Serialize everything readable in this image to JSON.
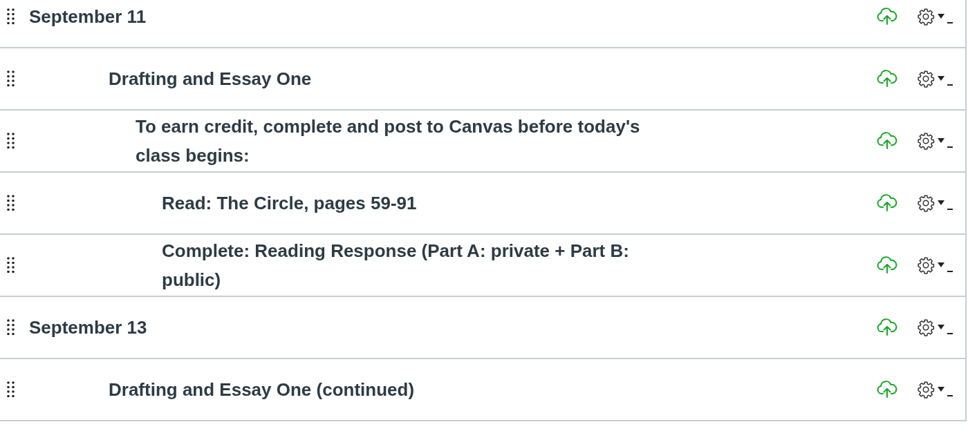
{
  "module_items": [
    {
      "title": "September 11",
      "published": true,
      "children": [
        {
          "title": "Drafting and Essay One",
          "published": true,
          "children": [
            {
              "title": "To earn credit, complete and post to Canvas before today's class begins:",
              "published": true,
              "children": [
                {
                  "title": "Read: The Circle, pages 59-91",
                  "published": true
                },
                {
                  "title": "Complete: Reading Response (Part A: private + Part B: public)",
                  "published": true
                }
              ]
            }
          ]
        }
      ]
    },
    {
      "title": "September 13",
      "published": true,
      "children": [
        {
          "title": "Drafting and Essay One (continued)",
          "published": true
        }
      ]
    }
  ]
}
